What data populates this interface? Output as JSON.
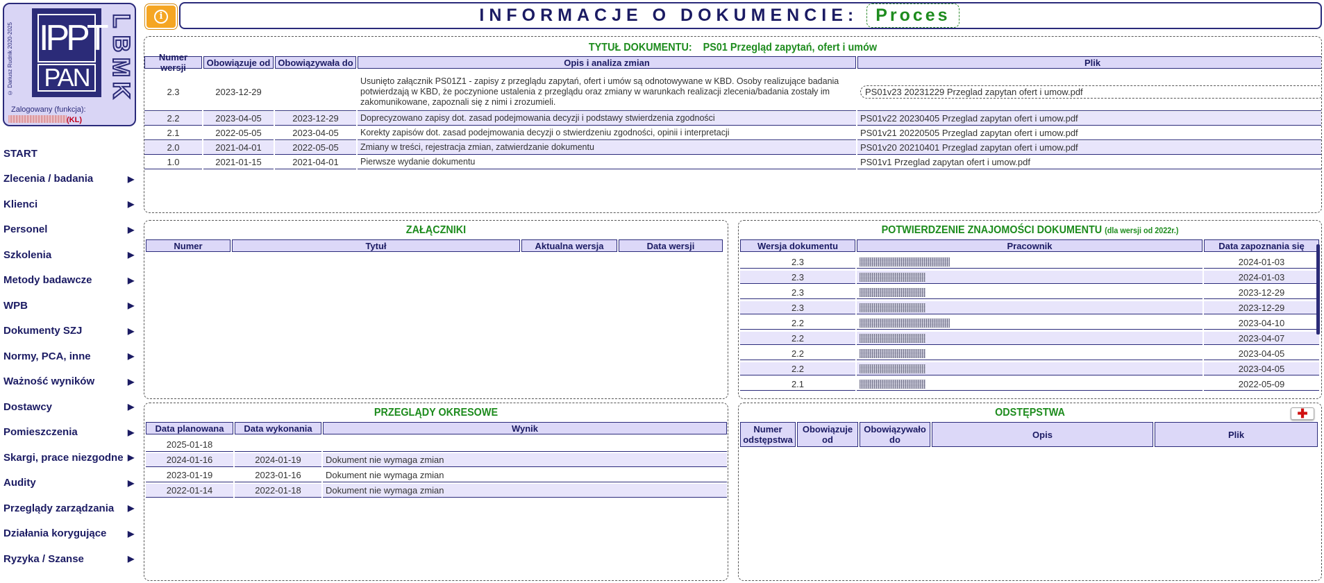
{
  "sidebar": {
    "copyright": "© Dariusz Rudnik 2020-2025",
    "logo_top": "IPPT",
    "logo_bottom": "PAN",
    "logo_side": [
      "L",
      "B",
      "M",
      "K"
    ],
    "logged_label": "Zalogowany (funkcja):",
    "logged_role": "(KL)",
    "nav": [
      {
        "label": "START",
        "arrow": ""
      },
      {
        "label": "Zlecenia / badania",
        "arrow": "▶"
      },
      {
        "label": "Klienci",
        "arrow": "▶"
      },
      {
        "label": "Personel",
        "arrow": "▶"
      },
      {
        "label": "Szkolenia",
        "arrow": "▶"
      },
      {
        "label": "Metody badawcze",
        "arrow": "▶"
      },
      {
        "label": "WPB",
        "arrow": "▶"
      },
      {
        "label": "Dokumenty SZJ",
        "arrow": "▶"
      },
      {
        "label": "Normy, PCA, inne",
        "arrow": "▶"
      },
      {
        "label": "Ważność wyników",
        "arrow": "▶"
      },
      {
        "label": "Dostawcy",
        "arrow": "▶"
      },
      {
        "label": "Pomieszczenia",
        "arrow": "▶"
      },
      {
        "label": "Skargi, prace niezgodne",
        "arrow": "▶"
      },
      {
        "label": "Audity",
        "arrow": "▶"
      },
      {
        "label": "Przeglądy zarządzania",
        "arrow": "▶"
      },
      {
        "label": "Działania korygujące",
        "arrow": "▶"
      },
      {
        "label": "Ryzyka / Szanse",
        "arrow": "▶"
      }
    ]
  },
  "header": {
    "info_icon": "i",
    "title": "INFORMACJE O DOKUMENCIE:",
    "doc_type": "Proces"
  },
  "document": {
    "title_label": "TYTUŁ DOKUMENTU:",
    "title_value": "PS01 Przegląd zapytań, ofert i umów",
    "columns": [
      "Numer wersji",
      "Obowiązuje od",
      "Obowiązywała do",
      "Opis i analiza zmian",
      "Plik"
    ],
    "versions": [
      {
        "num": "2.3",
        "from": "2023-12-29",
        "to": "",
        "desc": "Usunięto załącznik PS01Z1 - zapisy z przeglądu zapytań, ofert i umów są odnotowywane w KBD. Osoby realizujące badania potwierdzają w KBD, że poczynione ustalenia z przeglądu oraz zmiany w warunkach realizacji zlecenia/badania zostały im zakomunikowane, zapoznali się z nimi i zrozumieli.",
        "file": "PS01v23 20231229 Przeglad zapytan ofert i umow.pdf"
      },
      {
        "num": "2.2",
        "from": "2023-04-05",
        "to": "2023-12-29",
        "desc": "Doprecyzowano zapisy dot. zasad podejmowania decyzji i podstawy stwierdzenia zgodności",
        "file": "PS01v22 20230405 Przeglad zapytan ofert i umow.pdf"
      },
      {
        "num": "2.1",
        "from": "2022-05-05",
        "to": "2023-04-05",
        "desc": "Korekty zapisów dot. zasad podejmowania decyzji o stwierdzeniu zgodności, opinii i interpretacji",
        "file": "PS01v21 20220505 Przeglad zapytan ofert i umow.pdf"
      },
      {
        "num": "2.0",
        "from": "2021-04-01",
        "to": "2022-05-05",
        "desc": "Zmiany w treści, rejestracja zmian, zatwierdzanie dokumentu",
        "file": "PS01v20 20210401 Przeglad zapytan ofert i umow.pdf"
      },
      {
        "num": "1.0",
        "from": "2021-01-15",
        "to": "2021-04-01",
        "desc": "Pierwsze wydanie dokumentu",
        "file": "PS01v1 Przeglad zapytan ofert i umow.pdf"
      }
    ]
  },
  "attachments": {
    "title": "ZAŁĄCZNIKI",
    "columns": [
      "Numer",
      "Tytuł",
      "Aktualna wersja",
      "Data wersji"
    ]
  },
  "acknowledgement": {
    "title": "POTWIERDZENIE ZNAJOMOŚCI DOKUMENTU",
    "title_note": "(dla wersji od 2022r.)",
    "columns": [
      "Wersja dokumentu",
      "Pracownik",
      "Data zapoznania się"
    ],
    "rows": [
      {
        "version": "2.3",
        "date": "2024-01-03"
      },
      {
        "version": "2.3",
        "date": "2024-01-03"
      },
      {
        "version": "2.3",
        "date": "2023-12-29"
      },
      {
        "version": "2.3",
        "date": "2023-12-29"
      },
      {
        "version": "2.2",
        "date": "2023-04-10"
      },
      {
        "version": "2.2",
        "date": "2023-04-07"
      },
      {
        "version": "2.2",
        "date": "2023-04-05"
      },
      {
        "version": "2.2",
        "date": "2023-04-05"
      },
      {
        "version": "2.1",
        "date": "2022-05-09"
      }
    ]
  },
  "reviews": {
    "title": "PRZEGLĄDY OKRESOWE",
    "columns": [
      "Data planowana",
      "Data wykonania",
      "Wynik"
    ],
    "rows": [
      {
        "planned": "2025-01-18",
        "done": "",
        "result": ""
      },
      {
        "planned": "2024-01-16",
        "done": "2024-01-19",
        "result": "Dokument nie wymaga zmian"
      },
      {
        "planned": "2023-01-19",
        "done": "2023-01-16",
        "result": "Dokument nie wymaga zmian"
      },
      {
        "planned": "2022-01-14",
        "done": "2022-01-18",
        "result": "Dokument nie wymaga zmian"
      }
    ]
  },
  "deviations": {
    "title": "ODSTĘPSTWA",
    "add_label": "✚",
    "columns": [
      "Numer odstępstwa",
      "Obowiązuje od",
      "Obowiązywało do",
      "Opis",
      "Plik"
    ]
  }
}
